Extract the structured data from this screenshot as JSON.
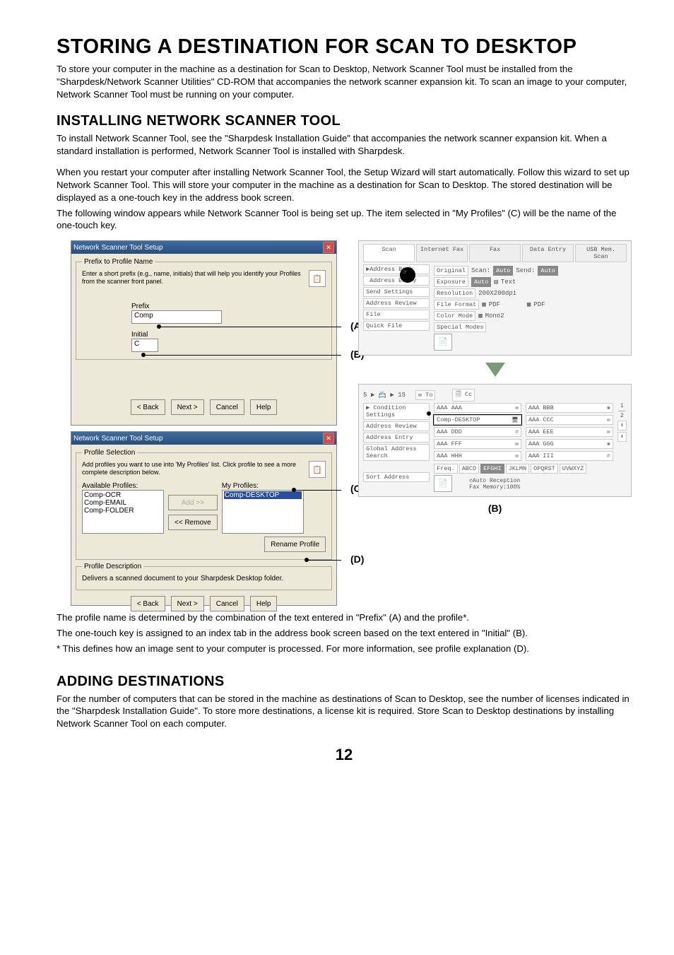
{
  "title": "STORING A DESTINATION FOR SCAN TO DESKTOP",
  "intro": "To store your computer in the machine as a destination for Scan to Desktop, Network Scanner Tool must be installed from the \"Sharpdesk/Network Scanner Utilities\" CD-ROM that accompanies the network scanner expansion kit. To scan an image to your computer, Network Scanner Tool must be running on your computer.",
  "h2_install": "INSTALLING NETWORK SCANNER TOOL",
  "install_p1": "To install Network Scanner Tool, see the \"Sharpdesk Installation Guide\" that accompanies the network scanner expansion kit. When a standard installation is performed, Network Scanner Tool is installed with Sharpdesk.",
  "install_p2": "When you restart your computer after installing Network Scanner Tool, the Setup Wizard will start automatically. Follow this wizard to set up Network Scanner Tool. This will store your computer in the machine as a destination for Scan to Desktop. The stored destination will be displayed as a one-touch key in the address book screen.",
  "install_p3": "The following window appears while Network Scanner Tool is being set up. The item selected in \"My Profiles\" (C) will be the name of the one-touch key.",
  "win1": {
    "title": "Network Scanner Tool Setup",
    "group": "Prefix to Profile Name",
    "hint": "Enter a short prefix (e.g., name, initials) that will help you identify your Profiles from the scanner front panel.",
    "prefix_label": "Prefix",
    "prefix_value": "Comp",
    "initial_label": "Initial",
    "initial_value": "C",
    "buttons": {
      "back": "< Back",
      "next": "Next >",
      "cancel": "Cancel",
      "help": "Help"
    }
  },
  "win2": {
    "title": "Network Scanner Tool Setup",
    "group": "Profile Selection",
    "hint": "Add profiles you want to use into 'My Profiles' list. Click profile to see a more complete description below.",
    "avail_label": "Available Profiles:",
    "avail": [
      "Comp-OCR",
      "Comp-EMAIL",
      "Comp-FOLDER"
    ],
    "my_label": "My Profiles:",
    "my_selected": "Comp-DESKTOP",
    "add": "Add >>",
    "remove": "<< Remove",
    "rename": "Rename Profile",
    "desc_group": "Profile Description",
    "desc": "Delivers a scanned document to your Sharpdesk Desktop folder."
  },
  "labels": {
    "A": "(A)",
    "B": "(B)",
    "C": "(C)",
    "D": "(D)"
  },
  "panel1": {
    "tabs": [
      "Scan",
      "Internet Fax",
      "Fax",
      "Data Entry",
      "USB Mem. Scan"
    ],
    "side": [
      "Address Book",
      "Address Entry",
      "Send Settings",
      "Address Review",
      "File",
      "Quick File"
    ],
    "rows": {
      "original": "Original",
      "scan": "Scan:",
      "auto1": "Auto",
      "send": "Send:",
      "auto2": "Auto",
      "exposure": "Exposure",
      "auto3": "Auto",
      "text": "Text",
      "resolution": "Resolution",
      "resval": "200X200dpi",
      "fileformat": "File Format",
      "pdf": "PDF",
      "pdf2": "PDF",
      "colormode": "Color Mode",
      "mono": "Mono2",
      "special": "Special Modes"
    }
  },
  "panel2": {
    "top": {
      "count": "5 ▶ 📇 ▶ 15",
      "to": "To",
      "cc": "Cc"
    },
    "side": [
      "Condition Settings",
      "Address Review",
      "Address Entry",
      "Global Address Search"
    ],
    "entries": [
      {
        "l": "AAA AAA",
        "r": "AAA BBB"
      },
      {
        "l": "Comp-DESKTOP",
        "r": "AAA CCC"
      },
      {
        "l": "AAA DDD",
        "r": "AAA EEE"
      },
      {
        "l": "AAA FFF",
        "r": "AAA GGG"
      },
      {
        "l": "AAA HHH",
        "r": "AAA III"
      }
    ],
    "alpha": [
      "Freq.",
      "ABCD",
      "EFGHI",
      "JKLMN",
      "OPQRST",
      "UVWXYZ"
    ],
    "sort": "Sort Address",
    "status1": "Auto Reception",
    "status2": "Fax Memory:100%",
    "nums": [
      "1",
      "2"
    ],
    "label_b": "(B)"
  },
  "after_fig_1": "The profile name is determined by the combination of the text entered in \"Prefix\" (A) and the profile*.",
  "after_fig_2": "The one-touch key is assigned to an index tab in the address book screen based on the text entered in \"Initial\" (B).",
  "after_fig_3": "*  This defines how an image sent to your computer is processed. For more information, see profile explanation (D).",
  "h2_add": "ADDING DESTINATIONS",
  "add_p": "For the number of computers that can be stored in the machine as destinations of Scan to Desktop, see the number of licenses indicated in the \"Sharpdesk Installation Guide\". To store more destinations, a license kit is required. Store Scan to Desktop destinations by installing Network Scanner Tool on each computer.",
  "pagenum": "12"
}
